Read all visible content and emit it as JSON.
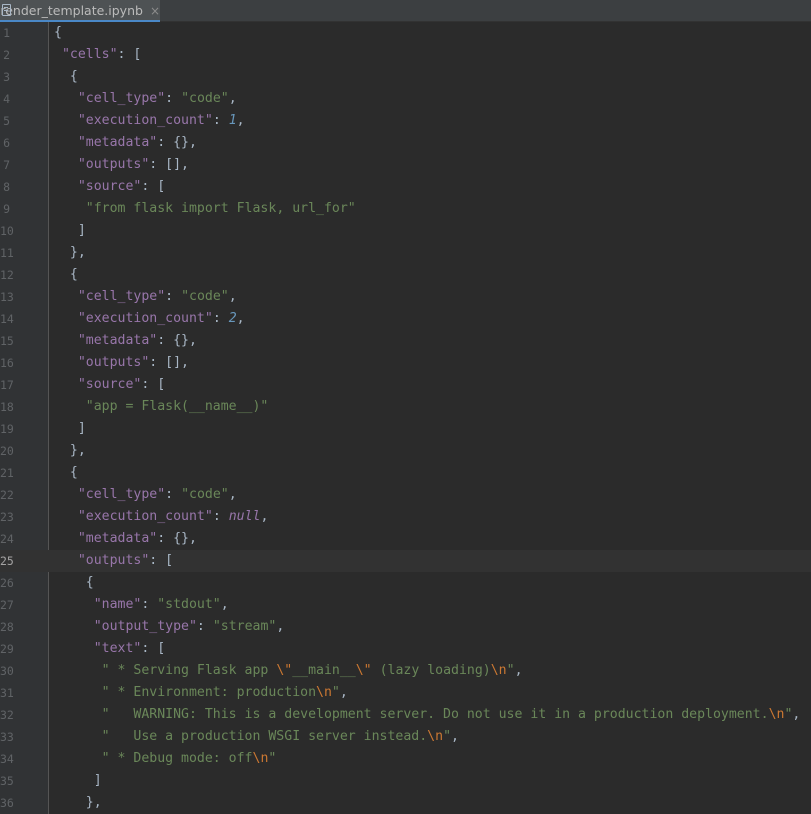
{
  "tab": {
    "title": "render_template.ipynb",
    "close": "×"
  },
  "current_line": 25,
  "lines": [
    [
      [
        "p",
        "{"
      ]
    ],
    [
      [
        "p",
        " "
      ],
      [
        "k",
        "\"cells\""
      ],
      [
        "p",
        ": ["
      ]
    ],
    [
      [
        "p",
        "  {"
      ]
    ],
    [
      [
        "p",
        "   "
      ],
      [
        "k",
        "\"cell_type\""
      ],
      [
        "p",
        ": "
      ],
      [
        "s",
        "\"code\""
      ],
      [
        "p",
        ","
      ]
    ],
    [
      [
        "p",
        "   "
      ],
      [
        "k",
        "\"execution_count\""
      ],
      [
        "p",
        ": "
      ],
      [
        "n",
        "1"
      ],
      [
        "p",
        ","
      ]
    ],
    [
      [
        "p",
        "   "
      ],
      [
        "k",
        "\"metadata\""
      ],
      [
        "p",
        ": {},"
      ]
    ],
    [
      [
        "p",
        "   "
      ],
      [
        "k",
        "\"outputs\""
      ],
      [
        "p",
        ": [],"
      ]
    ],
    [
      [
        "p",
        "   "
      ],
      [
        "k",
        "\"source\""
      ],
      [
        "p",
        ": ["
      ]
    ],
    [
      [
        "p",
        "    "
      ],
      [
        "s",
        "\"from flask import Flask, url_for\""
      ]
    ],
    [
      [
        "p",
        "   ]"
      ]
    ],
    [
      [
        "p",
        "  },"
      ]
    ],
    [
      [
        "p",
        "  {"
      ]
    ],
    [
      [
        "p",
        "   "
      ],
      [
        "k",
        "\"cell_type\""
      ],
      [
        "p",
        ": "
      ],
      [
        "s",
        "\"code\""
      ],
      [
        "p",
        ","
      ]
    ],
    [
      [
        "p",
        "   "
      ],
      [
        "k",
        "\"execution_count\""
      ],
      [
        "p",
        ": "
      ],
      [
        "n",
        "2"
      ],
      [
        "p",
        ","
      ]
    ],
    [
      [
        "p",
        "   "
      ],
      [
        "k",
        "\"metadata\""
      ],
      [
        "p",
        ": {},"
      ]
    ],
    [
      [
        "p",
        "   "
      ],
      [
        "k",
        "\"outputs\""
      ],
      [
        "p",
        ": [],"
      ]
    ],
    [
      [
        "p",
        "   "
      ],
      [
        "k",
        "\"source\""
      ],
      [
        "p",
        ": ["
      ]
    ],
    [
      [
        "p",
        "    "
      ],
      [
        "s",
        "\"app = Flask(__name__)\""
      ]
    ],
    [
      [
        "p",
        "   ]"
      ]
    ],
    [
      [
        "p",
        "  },"
      ]
    ],
    [
      [
        "p",
        "  {"
      ]
    ],
    [
      [
        "p",
        "   "
      ],
      [
        "k",
        "\"cell_type\""
      ],
      [
        "p",
        ": "
      ],
      [
        "s",
        "\"code\""
      ],
      [
        "p",
        ","
      ]
    ],
    [
      [
        "p",
        "   "
      ],
      [
        "k",
        "\"execution_count\""
      ],
      [
        "p",
        ": "
      ],
      [
        "kw",
        "null"
      ],
      [
        "p",
        ","
      ]
    ],
    [
      [
        "p",
        "   "
      ],
      [
        "k",
        "\"metadata\""
      ],
      [
        "p",
        ": {},"
      ]
    ],
    [
      [
        "p",
        "   "
      ],
      [
        "k",
        "\"outputs\""
      ],
      [
        "p",
        ": ["
      ]
    ],
    [
      [
        "p",
        "    {"
      ]
    ],
    [
      [
        "p",
        "     "
      ],
      [
        "k",
        "\"name\""
      ],
      [
        "p",
        ": "
      ],
      [
        "s",
        "\"stdout\""
      ],
      [
        "p",
        ","
      ]
    ],
    [
      [
        "p",
        "     "
      ],
      [
        "k",
        "\"output_type\""
      ],
      [
        "p",
        ": "
      ],
      [
        "s",
        "\"stream\""
      ],
      [
        "p",
        ","
      ]
    ],
    [
      [
        "p",
        "     "
      ],
      [
        "k",
        "\"text\""
      ],
      [
        "p",
        ": ["
      ]
    ],
    [
      [
        "p",
        "      "
      ],
      [
        "s",
        "\" * Serving Flask app "
      ],
      [
        "e",
        "\\\""
      ],
      [
        "s",
        "__main__"
      ],
      [
        "e",
        "\\\""
      ],
      [
        "s",
        " (lazy loading)"
      ],
      [
        "e",
        "\\n"
      ],
      [
        "s",
        "\""
      ],
      [
        "p",
        ","
      ]
    ],
    [
      [
        "p",
        "      "
      ],
      [
        "s",
        "\" * Environment: production"
      ],
      [
        "e",
        "\\n"
      ],
      [
        "s",
        "\""
      ],
      [
        "p",
        ","
      ]
    ],
    [
      [
        "p",
        "      "
      ],
      [
        "s",
        "\"   WARNING: This is a development server. Do not use it in a production deployment."
      ],
      [
        "e",
        "\\n"
      ],
      [
        "s",
        "\""
      ],
      [
        "p",
        ","
      ]
    ],
    [
      [
        "p",
        "      "
      ],
      [
        "s",
        "\"   Use a production WSGI server instead."
      ],
      [
        "e",
        "\\n"
      ],
      [
        "s",
        "\""
      ],
      [
        "p",
        ","
      ]
    ],
    [
      [
        "p",
        "      "
      ],
      [
        "s",
        "\" * Debug mode: off"
      ],
      [
        "e",
        "\\n"
      ],
      [
        "s",
        "\""
      ]
    ],
    [
      [
        "p",
        "     ]"
      ]
    ],
    [
      [
        "p",
        "    },"
      ]
    ]
  ]
}
